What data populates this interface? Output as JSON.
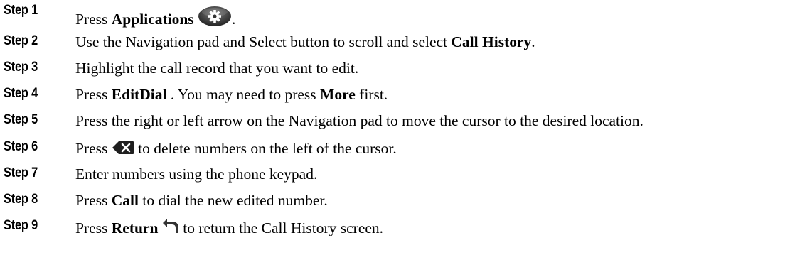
{
  "steps": [
    {
      "label": "Step 1",
      "parts": [
        {
          "t": "text",
          "v": "Press "
        },
        {
          "t": "bold",
          "v": "Applications"
        },
        {
          "t": "text",
          "v": " "
        },
        {
          "t": "icon",
          "icon": "applications-icon"
        },
        {
          "t": "text",
          "v": "."
        }
      ]
    },
    {
      "label": "Step 2",
      "parts": [
        {
          "t": "text",
          "v": "Use the Navigation pad and Select button to scroll and select "
        },
        {
          "t": "bold",
          "v": "Call History"
        },
        {
          "t": "text",
          "v": "."
        }
      ]
    },
    {
      "label": "Step 3",
      "parts": [
        {
          "t": "text",
          "v": "Highlight the call record that you want to edit."
        }
      ]
    },
    {
      "label": "Step 4",
      "parts": [
        {
          "t": "text",
          "v": "Press "
        },
        {
          "t": "bold",
          "v": "EditDial"
        },
        {
          "t": "text",
          "v": " . You may need to press "
        },
        {
          "t": "bold",
          "v": "More"
        },
        {
          "t": "text",
          "v": " first."
        }
      ]
    },
    {
      "label": "Step 5",
      "parts": [
        {
          "t": "text",
          "v": "Press the right or left arrow on the Navigation pad to move the cursor to the desired location."
        }
      ]
    },
    {
      "label": "Step 6",
      "parts": [
        {
          "t": "text",
          "v": "Press "
        },
        {
          "t": "icon",
          "icon": "backspace-icon"
        },
        {
          "t": "text",
          "v": " to delete numbers on the left of the cursor."
        }
      ]
    },
    {
      "label": "Step 7",
      "parts": [
        {
          "t": "text",
          "v": "Enter numbers using the phone keypad."
        }
      ]
    },
    {
      "label": "Step 8",
      "parts": [
        {
          "t": "text",
          "v": "Press "
        },
        {
          "t": "bold",
          "v": "Call"
        },
        {
          "t": "text",
          "v": "  to dial the new edited number."
        }
      ]
    },
    {
      "label": "Step 9",
      "parts": [
        {
          "t": "text",
          "v": "Press "
        },
        {
          "t": "bold",
          "v": "Return"
        },
        {
          "t": "text",
          "v": " "
        },
        {
          "t": "icon",
          "icon": "return-icon"
        },
        {
          "t": "text",
          "v": " to return the Call History screen."
        }
      ]
    }
  ]
}
